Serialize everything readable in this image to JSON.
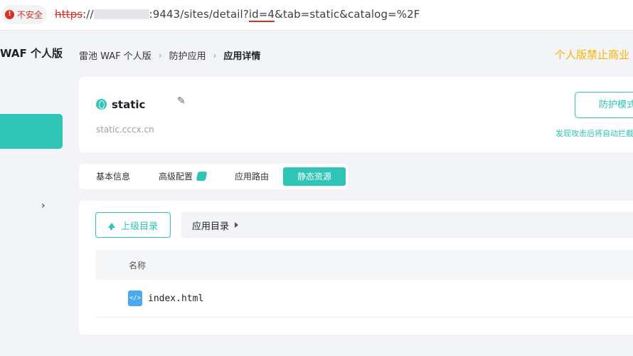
{
  "address_bar": {
    "security_label": "不安全",
    "url_scheme": "https",
    "url_sep": "://",
    "url_path_before": ":9443/sites/detail?",
    "url_highlight": "id=4",
    "url_path_after": "&tab=static&catalog=%2F"
  },
  "sidebar": {
    "brand": "WAF 个人版",
    "arrow": "›"
  },
  "breadcrumb": {
    "root": "雷池 WAF 个人版",
    "sep1": "›",
    "section": "防护应用",
    "sep2": "›",
    "current": "应用详情"
  },
  "banner": {
    "warning": "个人版禁止商业"
  },
  "site": {
    "name": "static",
    "domain": "static.cccx.cn",
    "protect_button": "防护模式",
    "protect_hint": "发现攻击后将自动拦截"
  },
  "tabs": [
    {
      "label": "基本信息"
    },
    {
      "label": "高级配置"
    },
    {
      "label": "应用路由"
    },
    {
      "label": "静态资源"
    }
  ],
  "files": {
    "up_button": "上级目录",
    "path": "应用目录",
    "column_name": "名称",
    "rows": [
      {
        "icon_text": "</>",
        "name": "index.html"
      }
    ]
  },
  "colors": {
    "accent": "#2ec4b6",
    "warning": "#f7b500",
    "insecure": "#d93025"
  }
}
